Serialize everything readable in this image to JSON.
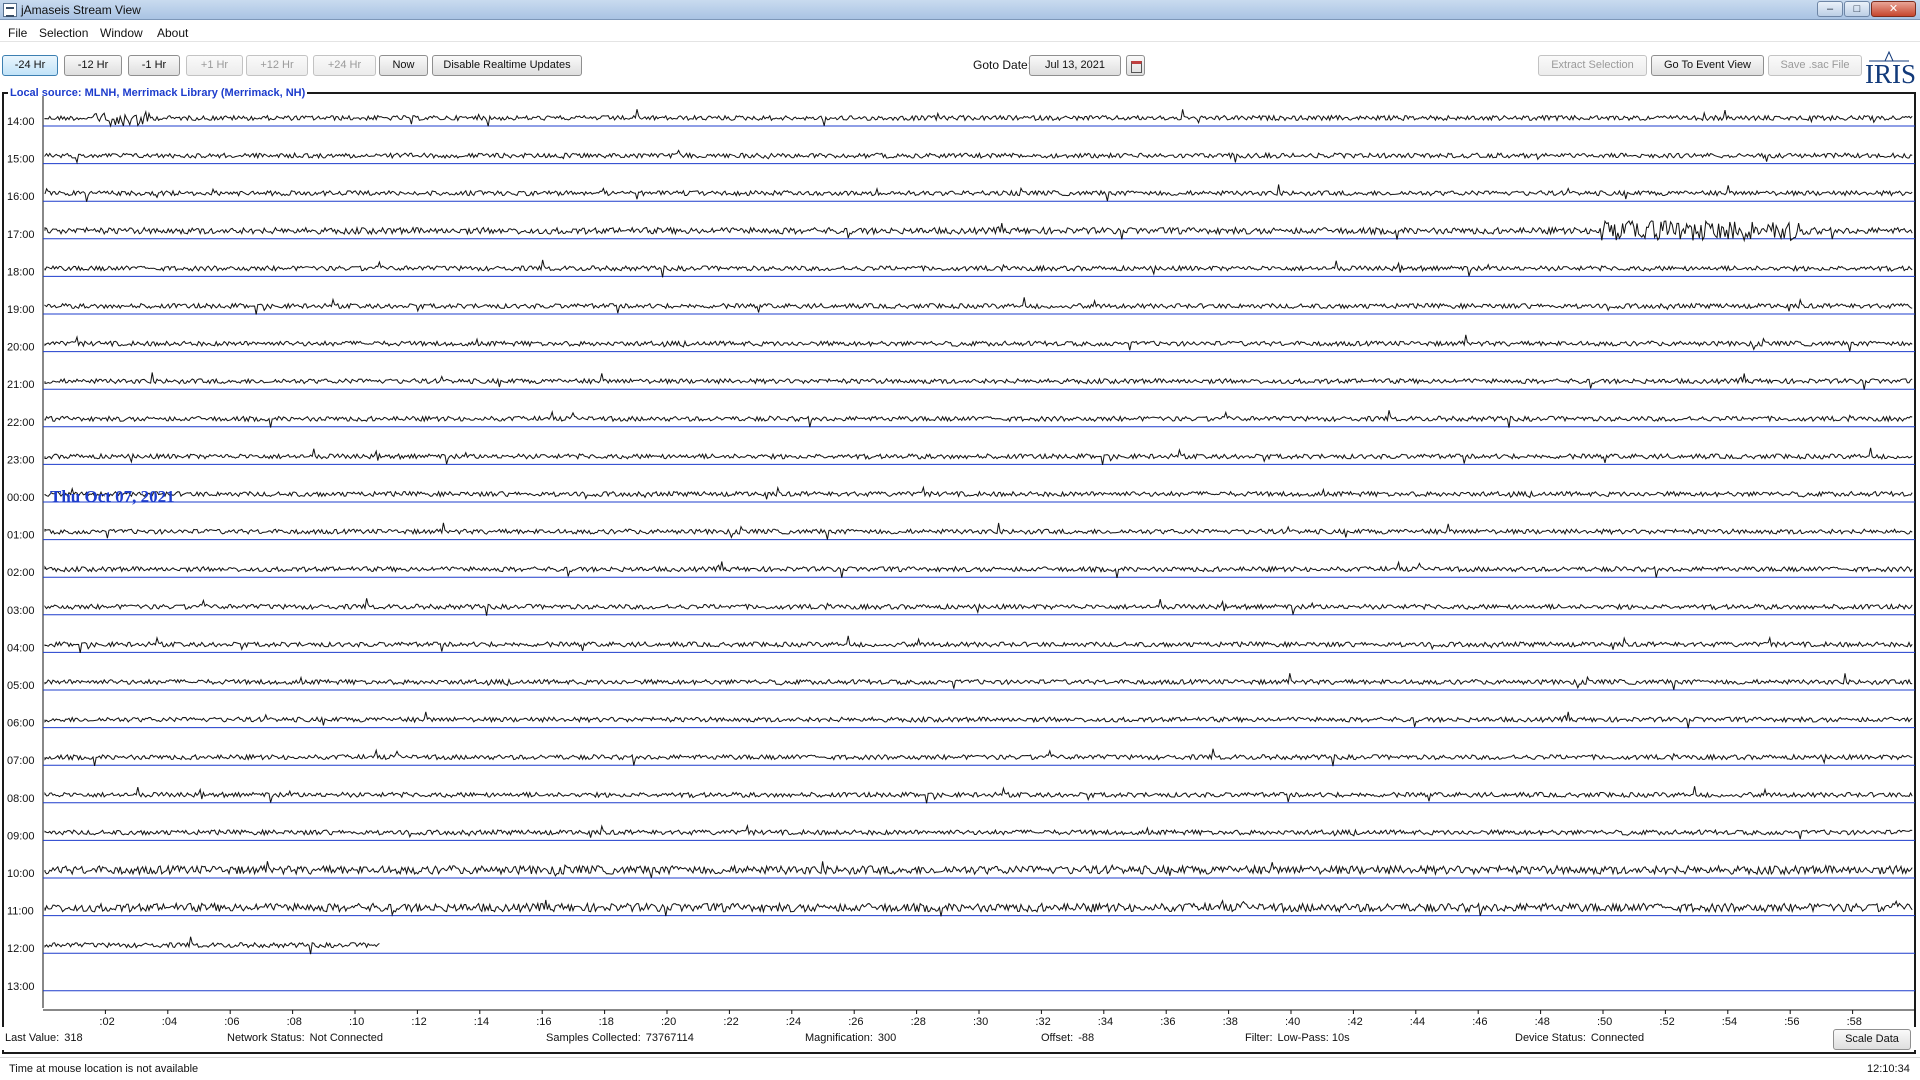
{
  "window": {
    "title": "jAmaseis Stream View"
  },
  "menu": [
    "File",
    "Selection",
    "Window",
    "About"
  ],
  "toolbar": {
    "nav_buttons": [
      {
        "label": "-24 Hr",
        "state": "active"
      },
      {
        "label": "-12 Hr",
        "state": "enabled"
      },
      {
        "label": "-1 Hr",
        "state": "enabled"
      },
      {
        "label": "+1 Hr",
        "state": "disabled"
      },
      {
        "label": "+12 Hr",
        "state": "disabled"
      },
      {
        "label": "+24 Hr",
        "state": "disabled"
      },
      {
        "label": "Now",
        "state": "enabled"
      },
      {
        "label": "Disable Realtime Updates",
        "state": "enabled"
      }
    ],
    "goto_label": "Goto Date:",
    "goto_value": "Jul 13, 2021",
    "extract_selection": "Extract Selection",
    "go_to_event_view": "Go To Event View",
    "save_sac": "Save .sac File",
    "logo_text": "IRIS"
  },
  "plot": {
    "source_label": "Local source: MLNH, Merrimack Library (Merrimack, NH)",
    "day_label": "Thu Oct 07, 2021",
    "hour_labels": [
      "14:00",
      "15:00",
      "16:00",
      "17:00",
      "18:00",
      "19:00",
      "20:00",
      "21:00",
      "22:00",
      "23:00",
      "00:00",
      "01:00",
      "02:00",
      "03:00",
      "04:00",
      "05:00",
      "06:00",
      "07:00",
      "08:00",
      "09:00",
      "10:00",
      "11:00",
      "12:00",
      "13:00"
    ],
    "minute_labels": [
      ":02",
      ":04",
      ":06",
      ":08",
      ":10",
      ":12",
      ":14",
      ":16",
      ":18",
      ":20",
      ":22",
      ":24",
      ":26",
      ":28",
      ":30",
      ":32",
      ":34",
      ":36",
      ":38",
      ":40",
      ":42",
      ":44",
      ":46",
      ":48",
      ":50",
      ":52",
      ":54",
      ":56",
      ":58"
    ],
    "trace_color": "#111111",
    "gridline_color": "#1d3ccc",
    "current_row_end_minute": 10.5
  },
  "status": {
    "last_value_label": "Last Value:",
    "last_value": "318",
    "network_label": "Network Status:",
    "network": "Not Connected",
    "samples_label": "Samples Collected:",
    "samples": "73767114",
    "magnification_label": "Magnification:",
    "magnification": "300",
    "offset_label": "Offset:",
    "offset": "-88",
    "filter_label": "Filter:",
    "filter": "Low-Pass: 10s",
    "device_label": "Device Status:",
    "device": "Connected",
    "scale_button": "Scale Data",
    "mouse_info": "Time at mouse location is not available",
    "clock": "12:10:34"
  }
}
